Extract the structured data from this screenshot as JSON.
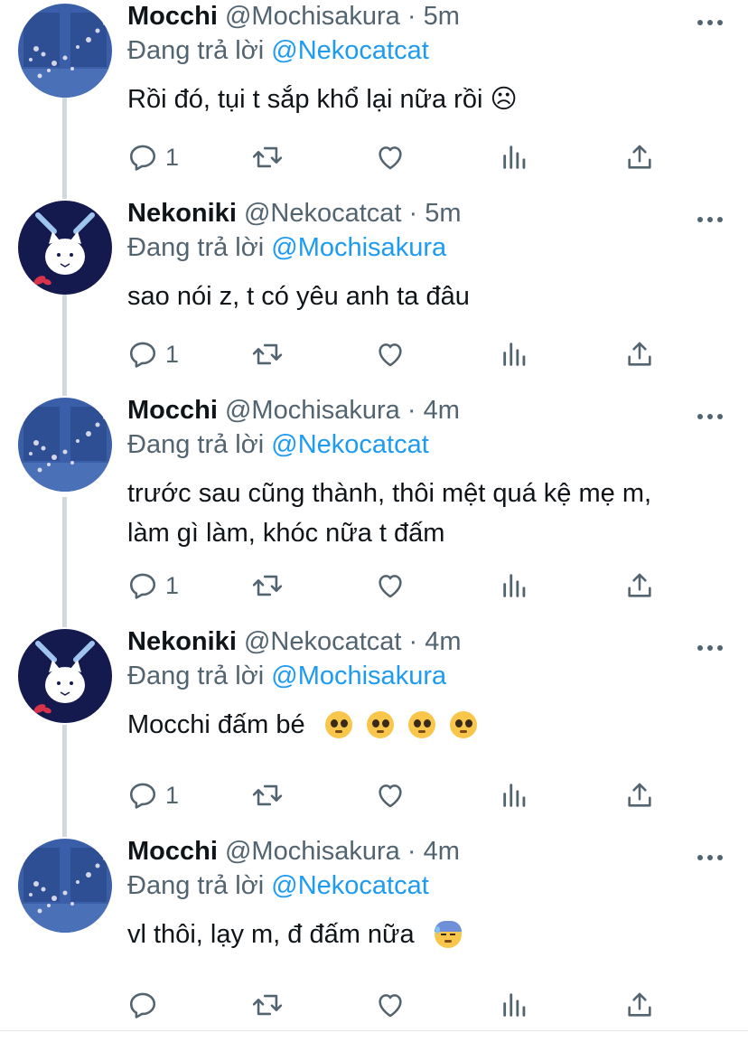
{
  "reply_prefix": "Đang trả lời",
  "tweets": [
    {
      "name": "Mocchi",
      "handle": "@Mochisakura",
      "dot": "·",
      "time": "5m",
      "reply_to": "@Nekocatcat",
      "text": "Rồi đó, tụi t sắp khổ lại nữa rồi ☹",
      "reply_count": "1",
      "avatar": "sakura-avatar"
    },
    {
      "name": "Nekoniki",
      "handle": "@Nekocatcat",
      "dot": "·",
      "time": "5m",
      "reply_to": "@Mochisakura",
      "text": "sao nói z, t có yêu anh ta đâu",
      "reply_count": "1",
      "avatar": "cat-avatar"
    },
    {
      "name": "Mocchi",
      "handle": "@Mochisakura",
      "dot": "·",
      "time": "4m",
      "reply_to": "@Nekocatcat",
      "text_line1": "trước sau cũng thành, thôi mệt quá kệ mẹ m,",
      "text_line2": "làm gì làm, khóc nữa t đấm",
      "reply_count": "1",
      "avatar": "sakura-avatar"
    },
    {
      "name": "Nekoniki",
      "handle": "@Nekocatcat",
      "dot": "·",
      "time": "4m",
      "reply_to": "@Mochisakura",
      "text": "Mocchi đấm bé",
      "emoji": "pleading-face-emoji",
      "reply_count": "1",
      "avatar": "cat-avatar"
    },
    {
      "name": "Mocchi",
      "handle": "@Mochisakura",
      "dot": "·",
      "time": "4m",
      "reply_to": "@Nekocatcat",
      "text": "vl thôi, lạy m, đ đấm nữa",
      "emoji": "downcast-sweat-emoji",
      "reply_count": "",
      "avatar": "sakura-avatar"
    }
  ],
  "colors": {
    "link": "#1d9bf0",
    "muted": "#536471",
    "text": "#0f1419",
    "thread": "#cfd9de"
  }
}
